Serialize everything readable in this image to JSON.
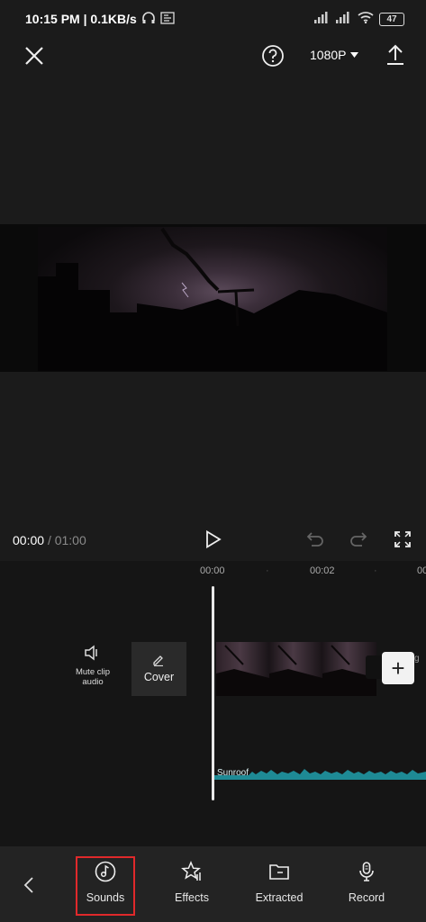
{
  "status_bar": {
    "time": "10:15 PM",
    "speed": "0.1KB/s",
    "battery": "47"
  },
  "toolbar": {
    "resolution": "1080P"
  },
  "player": {
    "current_time": "00:00",
    "total_time": "01:00"
  },
  "timeline": {
    "ticks": [
      "00:00",
      "00:02",
      "00"
    ],
    "mute_label": "Mute clip audio",
    "cover_label": "Cover",
    "add_symbol": "+",
    "audio_track_label": "Sunroof",
    "ending_label": "g"
  },
  "bottom_nav": {
    "items": [
      {
        "label": "Sounds",
        "icon": "music-note-icon"
      },
      {
        "label": "Effects",
        "icon": "star-effects-icon"
      },
      {
        "label": "Extracted",
        "icon": "folder-icon"
      },
      {
        "label": "Record",
        "icon": "microphone-icon"
      }
    ]
  },
  "colors": {
    "highlight": "#e0292b",
    "waveform": "#1e8a95",
    "background": "#1b1b1b"
  }
}
